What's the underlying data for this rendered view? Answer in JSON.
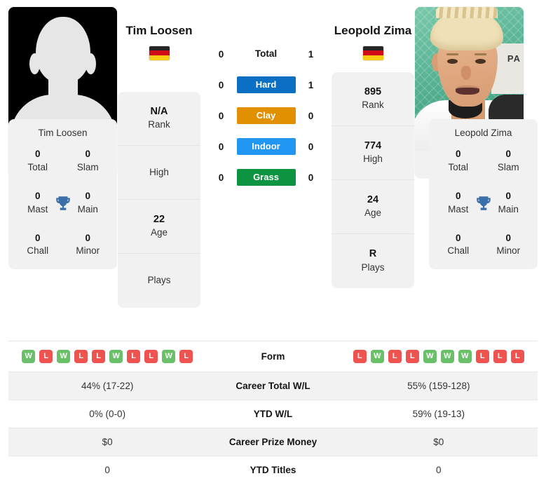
{
  "left_player": {
    "name": "Tim Loosen",
    "photo_caption": "Tim Loosen",
    "photo_type": "silhouette-placeholder",
    "flag": {
      "name": "germany-flag",
      "colors": [
        "#262626",
        "#d10b17",
        "#f5cb13"
      ]
    },
    "info": [
      {
        "value": "N/A",
        "label": "Rank"
      },
      {
        "value": "",
        "label": "High"
      },
      {
        "value": "22",
        "label": "Age"
      },
      {
        "value": "",
        "label": "Plays"
      }
    ],
    "titles": {
      "card_name": "Tim Loosen",
      "stats": [
        {
          "value": "0",
          "label": "Total"
        },
        {
          "value": "0",
          "label": "Slam"
        },
        {
          "value": "0",
          "label": "Mast"
        },
        {
          "value": "0",
          "label": "Main"
        },
        {
          "value": "0",
          "label": "Chall"
        },
        {
          "value": "0",
          "label": "Minor"
        }
      ]
    },
    "surface_wins": {
      "total": "0",
      "hard": "0",
      "clay": "0",
      "indoor": "0",
      "grass": "0"
    },
    "form": [
      "W",
      "L",
      "W",
      "L",
      "L",
      "W",
      "L",
      "L",
      "W",
      "L"
    ],
    "career_total_wl": "44% (17-22)",
    "ytd_wl": "0% (0-0)",
    "career_prize_money": "$0",
    "ytd_titles": "0"
  },
  "right_player": {
    "name": "Leopold Zima",
    "photo_caption": "Leopold Zima",
    "photo_type": "player-photo",
    "photo_board_text": "PA",
    "flag": {
      "name": "germany-flag",
      "colors": [
        "#262626",
        "#d10b17",
        "#f5cb13"
      ]
    },
    "info": [
      {
        "value": "895",
        "label": "Rank"
      },
      {
        "value": "774",
        "label": "High"
      },
      {
        "value": "24",
        "label": "Age"
      },
      {
        "value": "R",
        "label": "Plays"
      }
    ],
    "titles": {
      "card_name": "Leopold Zima",
      "stats": [
        {
          "value": "0",
          "label": "Total"
        },
        {
          "value": "0",
          "label": "Slam"
        },
        {
          "value": "0",
          "label": "Mast"
        },
        {
          "value": "0",
          "label": "Main"
        },
        {
          "value": "0",
          "label": "Chall"
        },
        {
          "value": "0",
          "label": "Minor"
        }
      ]
    },
    "surface_wins": {
      "total": "1",
      "hard": "1",
      "clay": "0",
      "indoor": "0",
      "grass": "0"
    },
    "form": [
      "L",
      "W",
      "L",
      "L",
      "W",
      "W",
      "W",
      "L",
      "L",
      "L"
    ],
    "career_total_wl": "55% (159-128)",
    "ytd_wl": "59% (19-13)",
    "career_prize_money": "$0",
    "ytd_titles": "0"
  },
  "surfaces": [
    {
      "key": "total",
      "label": "Total",
      "style": "plain",
      "color": ""
    },
    {
      "key": "hard",
      "label": "Hard",
      "style": "pill",
      "color": "#0b6fc4"
    },
    {
      "key": "clay",
      "label": "Clay",
      "style": "pill",
      "color": "#e09000"
    },
    {
      "key": "indoor",
      "label": "Indoor",
      "style": "pill",
      "color": "#2196f3"
    },
    {
      "key": "grass",
      "label": "Grass",
      "style": "pill",
      "color": "#0d9440"
    }
  ],
  "table_rows": [
    {
      "label": "Form",
      "key": "form",
      "type": "form"
    },
    {
      "label": "Career Total W/L",
      "key": "career_total_wl",
      "type": "text"
    },
    {
      "label": "YTD W/L",
      "key": "ytd_wl",
      "type": "text"
    },
    {
      "label": "Career Prize Money",
      "key": "career_prize_money",
      "type": "text"
    },
    {
      "label": "YTD Titles",
      "key": "ytd_titles",
      "type": "text"
    }
  ],
  "badge_colors": {
    "win": "#6abf69",
    "loss": "#ef5350"
  },
  "trophy_color": "#3b6fa8",
  "icons": {
    "trophy": "trophy-icon"
  }
}
